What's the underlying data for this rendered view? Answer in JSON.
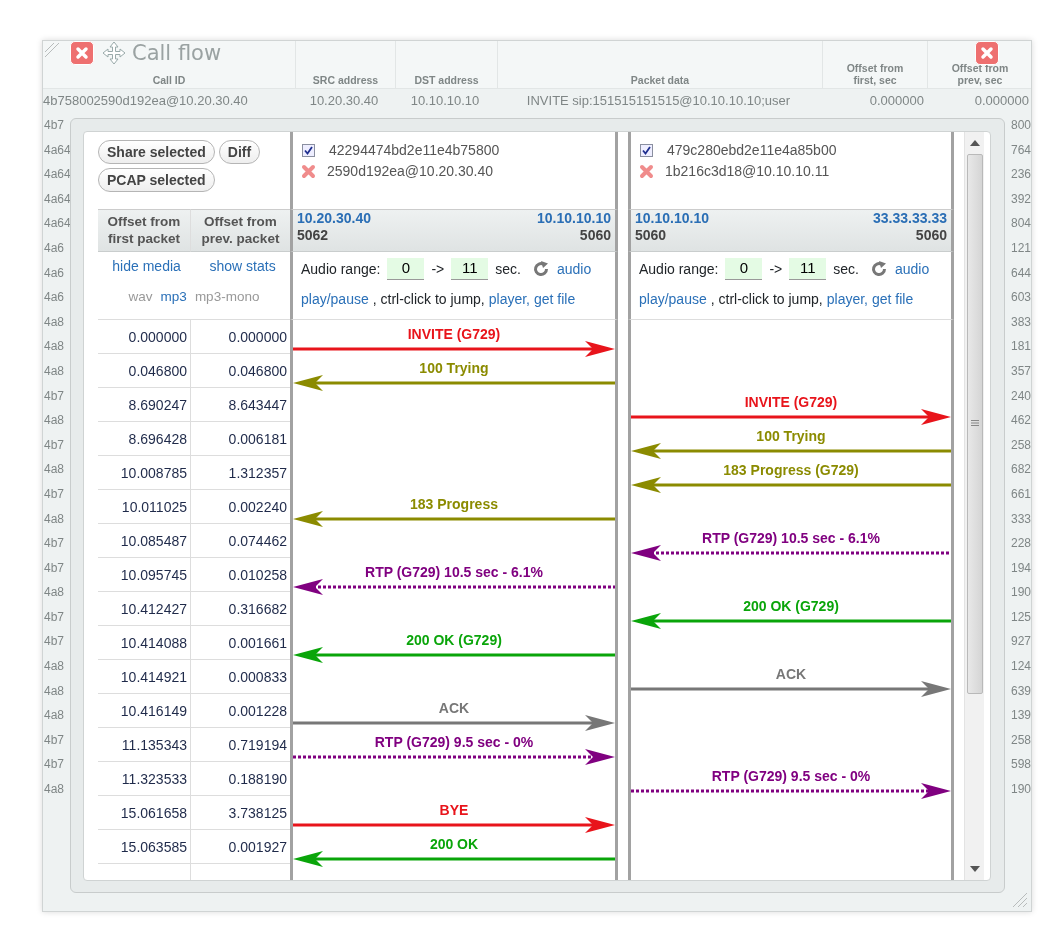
{
  "background_table": {
    "columns": [
      "Call ID",
      "SRC address",
      "DST address",
      "Packet data",
      "Offset from first, sec",
      "Offset from prev, sec"
    ],
    "first_row": [
      "4b758002590d192ea@10.20.30.40",
      "10.20.30.40",
      "10.10.10.10",
      "INVITE sip:151515151515@10.10.10.10;user",
      "0.000000",
      "0.000000"
    ],
    "left_column": [
      "4b7",
      "4a64",
      "4a64",
      "4a64",
      "4a64",
      "4a6",
      "4a6",
      "4a6",
      "4a8",
      "4a8",
      "4a8",
      "4b7",
      "4a8",
      "4b7",
      "4a8",
      "4b7",
      "4a8",
      "4b7",
      "4b7",
      "4a8",
      "4b7",
      "4b7",
      "4a8",
      "4a8",
      "4a8",
      "4b7",
      "4b7",
      "4a8"
    ],
    "right_column": [
      "800",
      "764",
      "236",
      "392",
      "804",
      "121",
      "644",
      "603",
      "383",
      "181",
      "357",
      "240",
      "462",
      "258",
      "682",
      "661",
      "333",
      "228",
      "194",
      "190",
      "125",
      "927",
      "124",
      "639",
      "139",
      "258",
      "598",
      "190"
    ]
  },
  "dialog": {
    "title": "Call flow"
  },
  "toolbar_buttons": [
    "Share selected",
    "Diff",
    "PCAP selected"
  ],
  "offset_headers": [
    "Offset from first packet",
    "Offset from prev. packet"
  ],
  "media_links": [
    "hide media",
    "show stats"
  ],
  "formats": [
    {
      "label": "wav",
      "selected": false
    },
    {
      "label": "mp3",
      "selected": true
    },
    {
      "label": "mp3-mono",
      "selected": false
    }
  ],
  "legs": [
    {
      "call_id": "42294474bd2e11e4b75800",
      "call_host": "2590d192ea@10.20.30.40",
      "checked": true,
      "src_ip": "10.20.30.40",
      "src_port": "5062",
      "dst_ip": "10.10.10.10",
      "dst_port": "5060",
      "audio_label": "Audio range:",
      "from": "0",
      "arrow": "->",
      "to": "11",
      "unit": "sec.",
      "audio_link": "audio",
      "controls": [
        {
          "kind": "link",
          "text": "play/pause"
        },
        {
          "kind": "text",
          "text": ", ctrl-click to jump,"
        },
        {
          "kind": "link",
          "text": "player,"
        },
        {
          "kind": "link",
          "text": "get file"
        }
      ]
    },
    {
      "call_id": "479c280ebd2e11e4a85b00",
      "call_host": "1b216c3d18@10.10.10.11",
      "checked": true,
      "src_ip": "10.10.10.10",
      "src_port": "5060",
      "dst_ip": "33.33.33.33",
      "dst_port": "5060",
      "audio_label": "Audio range:",
      "from": "0",
      "arrow": "->",
      "to": "11",
      "unit": "sec.",
      "audio_link": "audio",
      "controls": [
        {
          "kind": "link",
          "text": "play/pause"
        },
        {
          "kind": "text",
          "text": ", ctrl-click to jump,"
        },
        {
          "kind": "link",
          "text": "player,"
        },
        {
          "kind": "link",
          "text": "get file"
        }
      ]
    }
  ],
  "messages": [
    {
      "first": "0.000000",
      "prev": "0.000000",
      "leg_1": {
        "rightward": true,
        "kind": "signal",
        "label": "INVITE (G729)",
        "color": "#e8141b"
      }
    },
    {
      "first": "0.046800",
      "prev": "0.046800",
      "leg_1": {
        "rightward": false,
        "kind": "signal",
        "label": "100 Trying",
        "color": "#8b8b00"
      }
    },
    {
      "first": "8.690247",
      "prev": "8.643447",
      "leg_2": {
        "rightward": true,
        "kind": "signal",
        "label": "INVITE (G729)",
        "color": "#e8141b"
      }
    },
    {
      "first": "8.696428",
      "prev": "0.006181",
      "leg_2": {
        "rightward": false,
        "kind": "signal",
        "label": "100 Trying",
        "color": "#8b8b00"
      }
    },
    {
      "first": "10.008785",
      "prev": "1.312357",
      "leg_2": {
        "rightward": false,
        "kind": "signal",
        "label": "183 Progress (G729)",
        "color": "#8b8b00"
      }
    },
    {
      "first": "10.011025",
      "prev": "0.002240",
      "leg_1": {
        "rightward": false,
        "kind": "signal",
        "label": "183 Progress",
        "color": "#8b8b00"
      }
    },
    {
      "first": "10.085487",
      "prev": "0.074462",
      "leg_2": {
        "rightward": false,
        "kind": "media",
        "label": "RTP (G729) 10.5 sec - 6.1%",
        "color": "#800080"
      }
    },
    {
      "first": "10.095745",
      "prev": "0.010258",
      "leg_1": {
        "rightward": false,
        "kind": "media",
        "label": "RTP (G729) 10.5 sec - 6.1%",
        "color": "#800080"
      }
    },
    {
      "first": "10.412427",
      "prev": "0.316682",
      "leg_2": {
        "rightward": false,
        "kind": "signal",
        "label": "200 OK (G729)",
        "color": "#0aa50a"
      }
    },
    {
      "first": "10.414088",
      "prev": "0.001661",
      "leg_1": {
        "rightward": false,
        "kind": "signal",
        "label": "200 OK (G729)",
        "color": "#0aa50a"
      }
    },
    {
      "first": "10.414921",
      "prev": "0.000833",
      "leg_2": {
        "rightward": true,
        "kind": "signal",
        "label": "ACK",
        "color": "#777777"
      }
    },
    {
      "first": "10.416149",
      "prev": "0.001228",
      "leg_1": {
        "rightward": true,
        "kind": "signal",
        "label": "ACK",
        "color": "#777777"
      }
    },
    {
      "first": "11.135343",
      "prev": "0.719194",
      "leg_1": {
        "rightward": true,
        "kind": "media",
        "label": "RTP (G729) 9.5 sec - 0%",
        "color": "#800080"
      }
    },
    {
      "first": "11.323533",
      "prev": "0.188190",
      "leg_2": {
        "rightward": true,
        "kind": "media",
        "label": "RTP (G729) 9.5 sec - 0%",
        "color": "#800080"
      }
    },
    {
      "first": "15.061658",
      "prev": "3.738125",
      "leg_1": {
        "rightward": true,
        "kind": "signal",
        "label": "BYE",
        "color": "#e8141b"
      }
    },
    {
      "first": "15.063585",
      "prev": "0.001927",
      "leg_1": {
        "rightward": false,
        "kind": "signal",
        "label": "200 OK",
        "color": "#0aa50a"
      }
    }
  ]
}
